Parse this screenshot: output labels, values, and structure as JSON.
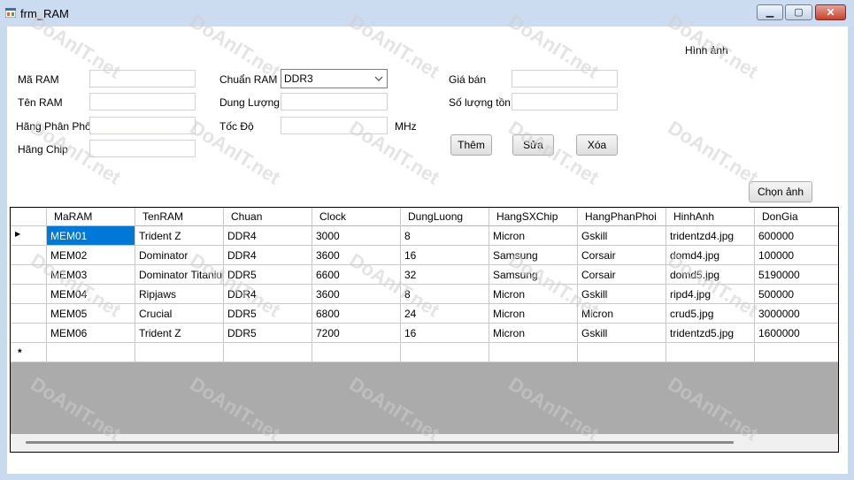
{
  "window": {
    "title": "frm_RAM",
    "controls": {
      "minimize": "▁",
      "maximize": "▢",
      "close": "✕"
    }
  },
  "form": {
    "image_label": "Hình ảnh",
    "fields": {
      "ma_ram": {
        "label": "Mã RAM",
        "value": ""
      },
      "ten_ram": {
        "label": "Tên RAM",
        "value": ""
      },
      "hang_phan_phoi": {
        "label": "Hãng Phân Phối",
        "value": ""
      },
      "hang_chip": {
        "label": "Hãng Chip",
        "value": ""
      },
      "chuan_ram": {
        "label": "Chuẩn RAM",
        "value": "DDR3"
      },
      "dung_luong": {
        "label": "Dung Lượng",
        "value": ""
      },
      "toc_do": {
        "label": "Tốc Độ",
        "value": "",
        "unit": "MHz"
      },
      "gia_ban": {
        "label": "Giá bán",
        "value": ""
      },
      "so_luong_ton": {
        "label": "Số lượng tồn",
        "value": ""
      }
    },
    "buttons": {
      "them": "Thêm",
      "sua": "Sửa",
      "xoa": "Xóa",
      "chon_anh": "Chọn ảnh"
    }
  },
  "grid": {
    "columns": [
      "MaRAM",
      "TenRAM",
      "Chuan",
      "Clock",
      "DungLuong",
      "HangSXChip",
      "HangPhanPhoi",
      "HinhAnh",
      "DonGia"
    ],
    "rows": [
      [
        "MEM01",
        "Trident Z",
        "DDR4",
        "3000",
        "8",
        "Micron",
        "Gskill",
        "tridentzd4.jpg",
        "600000"
      ],
      [
        "MEM02",
        "Dominator",
        "DDR4",
        "3600",
        "16",
        "Samsung",
        "Corsair",
        "domd4.jpg",
        "100000"
      ],
      [
        "MEM03",
        "Dominator Titanium",
        "DDR5",
        "6600",
        "32",
        "Samsung",
        "Corsair",
        "domd5.jpg",
        "5190000"
      ],
      [
        "MEM04",
        "Ripjaws",
        "DDR4",
        "3600",
        "8",
        "Micron",
        "Gskill",
        "ripd4.jpg",
        "500000"
      ],
      [
        "MEM05",
        "Crucial",
        "DDR5",
        "6800",
        "24",
        "Micron",
        "Micron",
        "crud5.jpg",
        "3000000"
      ],
      [
        "MEM06",
        "Trident Z",
        "DDR5",
        "7200",
        "16",
        "Micron",
        "Gskill",
        "tridentzd5.jpg",
        "1600000"
      ]
    ],
    "current_row_marker": "▶",
    "new_row_marker": "*"
  },
  "watermark": "DoAnIT.net",
  "colors": {
    "selection": "#0078d7",
    "titlebar": "#cbdcf0",
    "grid_empty": "#ababab"
  }
}
